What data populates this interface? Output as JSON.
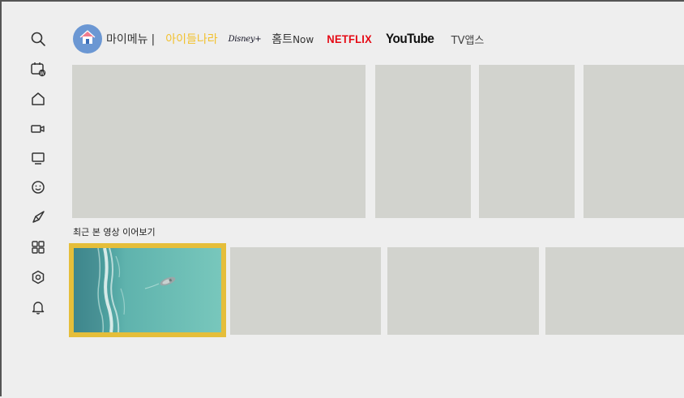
{
  "sidebar": {
    "icons": [
      {
        "name": "search-icon"
      },
      {
        "name": "tv-calendar-icon",
        "badge": "W"
      },
      {
        "name": "home-icon"
      },
      {
        "name": "video-camera-icon"
      },
      {
        "name": "monitor-icon"
      },
      {
        "name": "smiley-icon"
      },
      {
        "name": "rocket-icon"
      },
      {
        "name": "apps-grid-icon"
      },
      {
        "name": "settings-icon"
      },
      {
        "name": "bell-icon"
      }
    ]
  },
  "nav": {
    "avatar_icon": "house-icon",
    "my_menu": "마이메뉴",
    "separator": "|",
    "kids": "아이들나라",
    "disney": "Disney+",
    "homenow_prefix": "홈트",
    "homenow_suffix": "Now",
    "netflix": "NETFLIX",
    "youtube": "YouTube",
    "tvapps": "TV앱스"
  },
  "colors": {
    "active_nav": "#f2c12e",
    "focus_border": "#e5be3a",
    "netflix_red": "#e50914",
    "placeholder": "#d2d3ce",
    "avatar_bg": "#6b97d3"
  },
  "continue_watching": {
    "title": "최근 본 영상 이어보기",
    "items": [
      {
        "state": "focused",
        "thumbnail": "aerial-ocean-boat"
      },
      {
        "state": "placeholder"
      },
      {
        "state": "placeholder"
      },
      {
        "state": "placeholder"
      }
    ]
  }
}
